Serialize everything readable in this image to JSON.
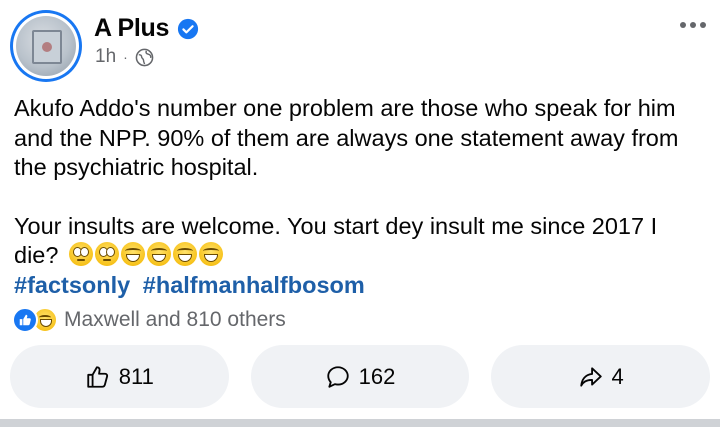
{
  "post": {
    "author": "A Plus",
    "time": "1h",
    "separator": "·",
    "line1": "Akufo Addo's number one problem are those who speak for him",
    "line2": "and the NPP. 90% of them are always one statement away from",
    "line3": "the psychiatric hospital.",
    "line4": "Your insults are welcome. You start dey insult me since 2017 I",
    "line5": "die?",
    "hashtag1": "#factsonly",
    "hashtag2": "#halfmanhalfbosom"
  },
  "reactions": {
    "summary": "Maxwell and 810 others"
  },
  "actions": {
    "like_count": "811",
    "comment_count": "162",
    "share_count": "4"
  },
  "colors": {
    "accent": "#1877f2",
    "hashtag": "#1e5fa8",
    "button_bg": "#f0f2f5",
    "muted": "#65676b"
  },
  "icons": [
    "verified-badge-icon",
    "globe-icon",
    "more-options-icon",
    "like-reaction-icon",
    "haha-reaction-icon",
    "thumbs-up-icon",
    "comment-icon",
    "share-icon"
  ]
}
